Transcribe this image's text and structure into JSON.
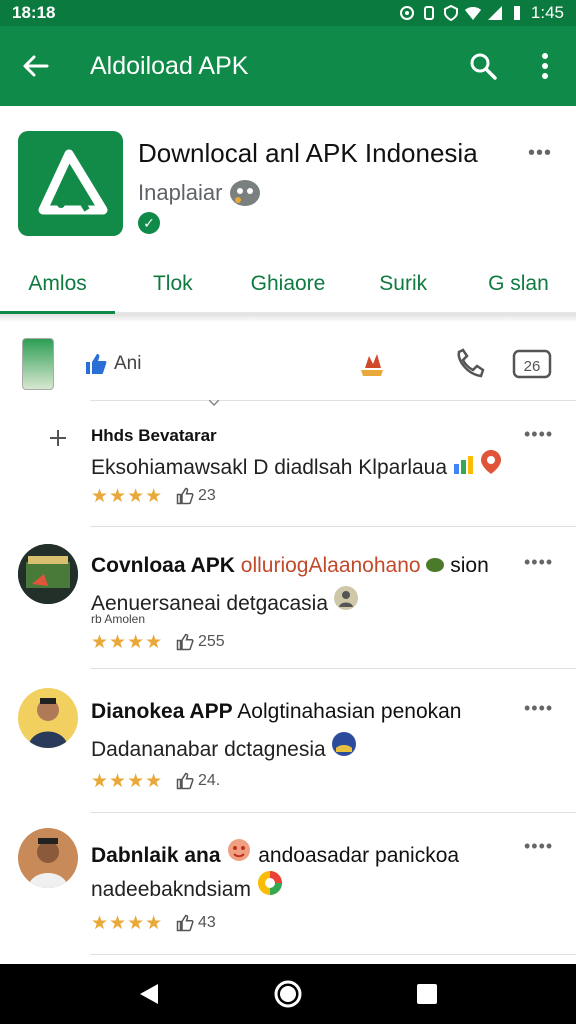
{
  "status_bar": {
    "time_left": "18:18",
    "time_right": "1:45"
  },
  "app_bar": {
    "title": "Aldoiload APK"
  },
  "header": {
    "app_name": "Downlocal anl APK Indonesia",
    "developer": "Inaplaiar",
    "verified_mark": "✓",
    "more": "•••"
  },
  "tabs": [
    {
      "label": "Amlos"
    },
    {
      "label": "Tlok"
    },
    {
      "label": "Ghiaore"
    },
    {
      "label": "Surik"
    },
    {
      "label": "G slan"
    }
  ],
  "filter_row": {
    "like_label": "Ani"
  },
  "reviews": [
    {
      "name": "Hhds Bevatarar",
      "body": "Eksohiamawsakl D diadlsah Klparlaua",
      "sub": "",
      "stars": "★★★★",
      "likes": "23",
      "more": "••••"
    },
    {
      "name": "Covnloaa APK",
      "name_extra": "olluriogAlaanohano",
      "name_tail": "sion",
      "body": "Aenuersaneai detgacasia",
      "sub": "rb Amolen",
      "stars": "★★★★",
      "likes": "255",
      "more": "••••"
    },
    {
      "name": "Dianokea APP",
      "name_extra": "Aolgtinahasian penokan",
      "body": "Dadananabar dctagnesia",
      "sub": "",
      "stars": "★★★★",
      "likes": "24.",
      "more": "••••"
    },
    {
      "name": "Dabnlaik ana",
      "name_extra": "andoasadar panickoa",
      "body": "nadeebakndsiam",
      "sub": "",
      "stars": "★★★★",
      "likes": "43",
      "more": "••••"
    }
  ],
  "colors": {
    "brand_green": "#0f8a48",
    "star": "#e8a83a"
  }
}
